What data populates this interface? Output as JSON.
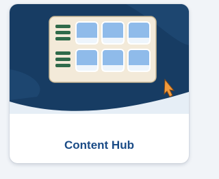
{
  "tile": {
    "label": "Content Hub",
    "illustration": "content-grid-illustration",
    "cursor_icon": "mouse-pointer-icon"
  },
  "colors": {
    "banner_navy": "#173c63",
    "wave_light": "#e6eef6",
    "panel_cream": "#f3ead9",
    "card_blue": "#8fbbea",
    "bar_green": "#2f6a4a",
    "cursor_orange": "#f29a3c",
    "label_blue": "#1a4b86"
  }
}
